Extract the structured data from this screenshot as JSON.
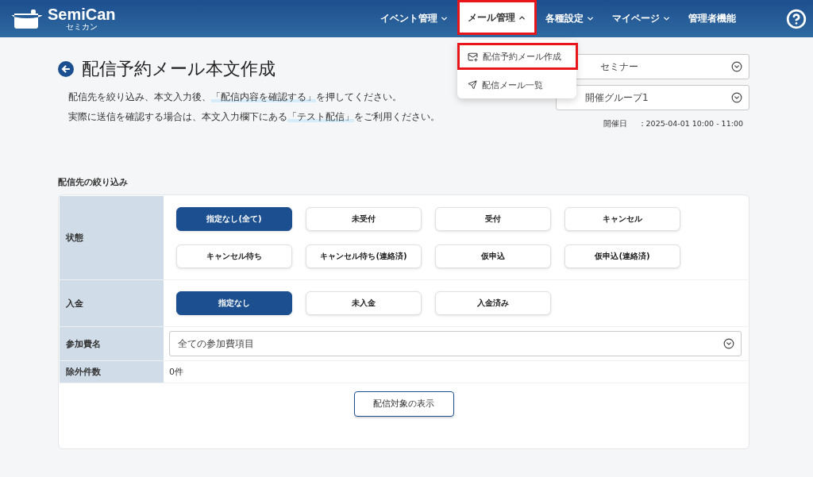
{
  "header": {
    "logo": {
      "name": "SemiCan",
      "kana": "セミカン"
    },
    "nav": [
      {
        "label": "イベント管理",
        "kind": "dropdown",
        "expanded": false,
        "highlighted": false
      },
      {
        "label": "メール管理",
        "kind": "dropdown",
        "expanded": true,
        "highlighted": true,
        "menu": [
          {
            "label": "配信予約メール作成",
            "kind": "compose",
            "highlighted": true
          },
          {
            "label": "配信メール一覧",
            "kind": "sent",
            "highlighted": false
          }
        ]
      },
      {
        "label": "各種設定",
        "kind": "dropdown",
        "expanded": false,
        "highlighted": false
      },
      {
        "label": "マイページ",
        "kind": "dropdown",
        "expanded": false,
        "highlighted": false
      },
      {
        "label": "管理者機能",
        "kind": "link",
        "highlighted": false
      }
    ]
  },
  "page": {
    "title": "配信予約メール本文作成",
    "description": [
      [
        {
          "text": "配信先を絞り込み、本文入力後、",
          "highlight": false
        },
        {
          "text": "「配信内容を確認する」",
          "highlight": true
        },
        {
          "text": "を押してください。",
          "highlight": false
        }
      ],
      [
        {
          "text": "実際に送信を確認する場合は、本文入力欄下にある",
          "highlight": false
        },
        {
          "text": "「テスト配信」",
          "highlight": true
        },
        {
          "text": "をご利用ください。",
          "highlight": false
        }
      ]
    ],
    "selects": [
      "セミナー",
      "開催グループ1"
    ],
    "date": {
      "label": "開催日",
      "value": "：2025-04-01 10:00 - 11:00"
    }
  },
  "filter": {
    "title": "配信先の絞り込み",
    "rows": [
      {
        "label": "状態",
        "kind": "buttons",
        "options": [
          {
            "label": "指定なし(全て)",
            "selected": true
          },
          {
            "label": "未受付",
            "selected": false
          },
          {
            "label": "受付",
            "selected": false
          },
          {
            "label": "キャンセル",
            "selected": false
          },
          {
            "label": "キャンセル待ち",
            "selected": false
          },
          {
            "label": "キャンセル待ち(連絡済)",
            "selected": false
          },
          {
            "label": "仮申込",
            "selected": false
          },
          {
            "label": "仮申込(連絡済)",
            "selected": false
          }
        ]
      },
      {
        "label": "入金",
        "kind": "buttons",
        "options": [
          {
            "label": "指定なし",
            "selected": true
          },
          {
            "label": "未入金",
            "selected": false
          },
          {
            "label": "入金済み",
            "selected": false
          }
        ]
      },
      {
        "label": "参加費名",
        "kind": "select",
        "value": "全ての参加費項目"
      },
      {
        "label": "除外件数",
        "kind": "text",
        "value": "0件"
      }
    ],
    "show_button": "配信対象の表示"
  }
}
